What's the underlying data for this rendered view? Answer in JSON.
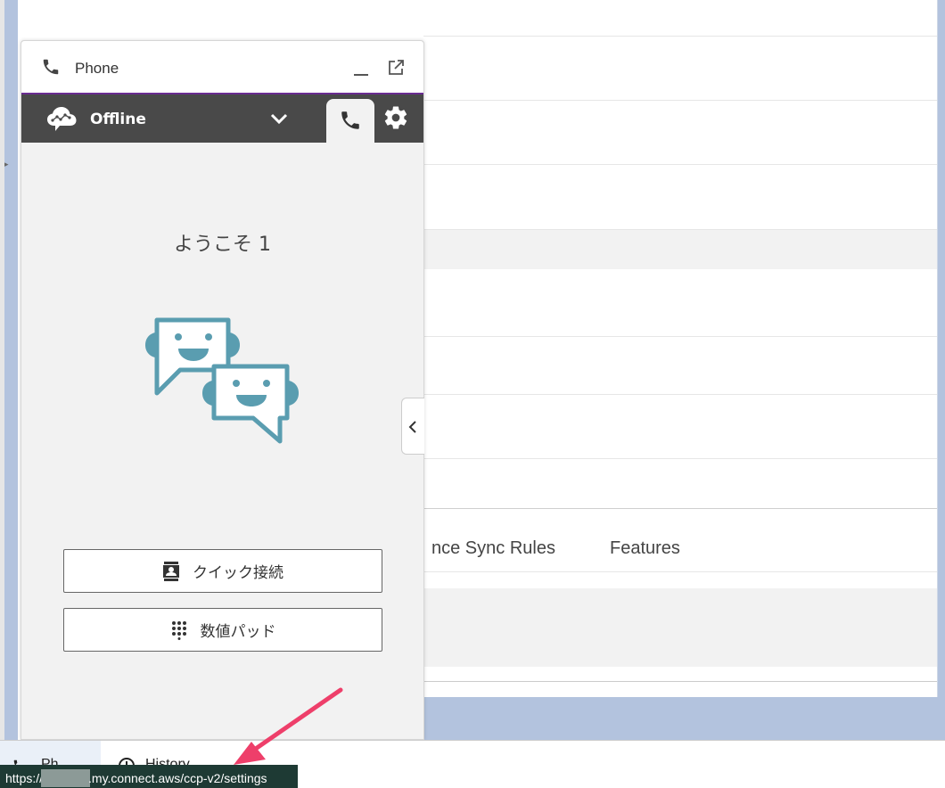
{
  "phone_panel": {
    "title": "Phone",
    "status": "Offline",
    "welcome": "ようこそ 1",
    "buttons": {
      "quick_connect": "クイック接続",
      "number_pad": "数値パッド"
    },
    "accent_color": "#6a2c91",
    "status_bar_color": "#494949",
    "illustration_color": "#5a9db0"
  },
  "host_page": {
    "tabs": [
      "nce Sync Rules",
      "Features"
    ]
  },
  "utility_bar": {
    "phone_label": "Ph",
    "history_label": "History"
  },
  "url_tooltip": {
    "prefix": "https://",
    "suffix": ".my.connect.aws/ccp-v2/settings"
  },
  "annotation_arrow_color": "#ee3f6a"
}
